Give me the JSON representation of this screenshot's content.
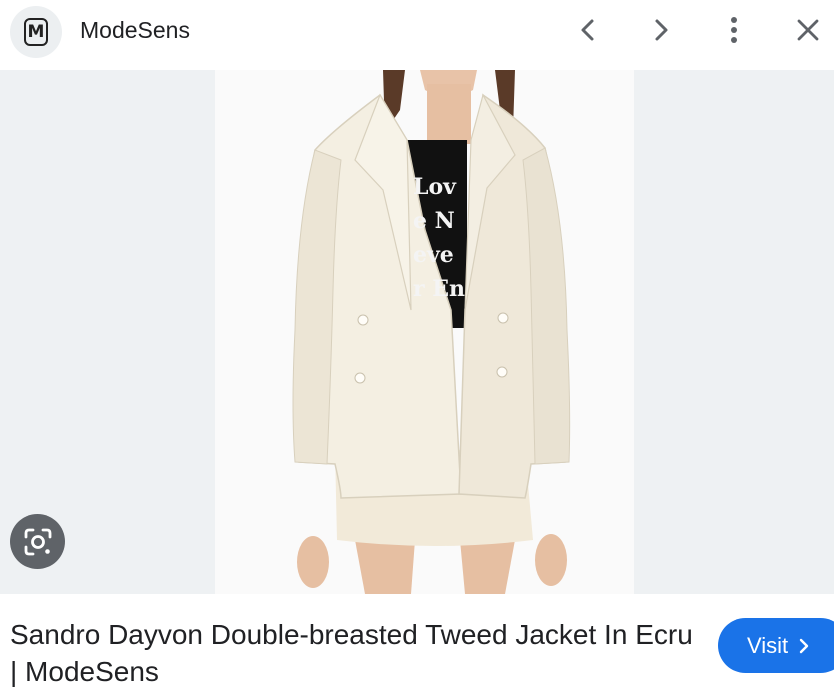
{
  "header": {
    "logo_letter": "M",
    "site_name": "ModeSens",
    "icons": [
      "chevron-left-icon",
      "chevron-right-icon",
      "more-vert-icon",
      "close-icon"
    ]
  },
  "image": {
    "shirt_text": "Love Never Ends",
    "lens_icon": "google-lens-icon"
  },
  "caption": {
    "title": "Sandro Dayvon Double-breasted Tweed Jacket In Ecru | ModeSens"
  },
  "visit": {
    "label": "Visit",
    "icon": "chevron-right-icon"
  },
  "colors": {
    "accent": "#1a73e8",
    "side_panel": "#eef1f3",
    "lens_button": "#5f6368",
    "text": "#202124"
  }
}
